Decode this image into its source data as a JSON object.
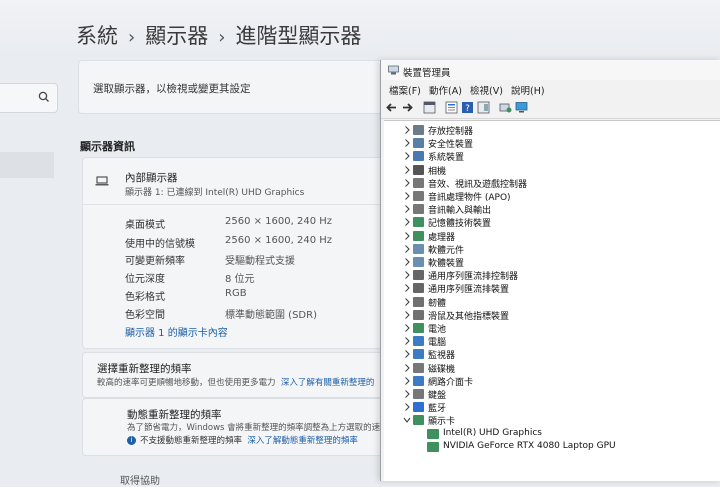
{
  "settings": {
    "breadcrumb": [
      "系統",
      "顯示器",
      "進階型顯示器"
    ],
    "select_display_label": "選取顯示器，以檢視或變更其設定",
    "display_info_title": "顯示器資訊",
    "display_name": "內部顯示器",
    "display_connection": "顯示器 1: 已連線到 Intel(R) UHD Graphics",
    "info_rows": [
      {
        "label": "桌面模式",
        "value": "2560 × 1600, 240 Hz"
      },
      {
        "label": "使用中的信號模",
        "value": "2560 × 1600, 240 Hz"
      },
      {
        "label": "可變更新頻率",
        "value": "受驅動程式支援"
      },
      {
        "label": "位元深度",
        "value": "8 位元"
      },
      {
        "label": "色彩格式",
        "value": "RGB"
      },
      {
        "label": "色彩空間",
        "value": "標準動態範圍 (SDR)"
      }
    ],
    "adapter_link": "顯示器 1 的顯示卡內容",
    "refresh_title": "選擇重新整理的頻率",
    "refresh_desc": "較高的速率可更順暢地移動，但也使用更多電力",
    "refresh_link": "深入了解有關重新整理的",
    "dynamic_title": "動態重新整理的頻率",
    "dynamic_desc": "為了節省電力，Windows 會將重新整理的頻率調整為上方選取的速",
    "dynamic_info": "不支援動態重新整理的頻率",
    "dynamic_link": "深入了解動態重新整理的頻率",
    "bottom_cut": "取得協助"
  },
  "device_manager": {
    "title": "裝置管理員",
    "menu": [
      "檔案(F)",
      "動作(A)",
      "檢視(V)",
      "說明(H)"
    ],
    "categories": [
      {
        "label": "存放控制器",
        "icon": "storage-icon",
        "color": "#6b7b8c"
      },
      {
        "label": "安全性裝置",
        "icon": "security-icon",
        "color": "#5a7fa6"
      },
      {
        "label": "系統裝置",
        "icon": "system-icon",
        "color": "#4a79b0"
      },
      {
        "label": "相機",
        "icon": "camera-icon",
        "color": "#555555"
      },
      {
        "label": "音效、視訊及遊戲控制器",
        "icon": "audio-icon",
        "color": "#777777"
      },
      {
        "label": "音訊處理物件 (APO)",
        "icon": "audio-icon",
        "color": "#777777"
      },
      {
        "label": "音訊輸入與輸出",
        "icon": "audio-io-icon",
        "color": "#777777"
      },
      {
        "label": "記憶體技術裝置",
        "icon": "memory-icon",
        "color": "#3f8f5f"
      },
      {
        "label": "處理器",
        "icon": "processor-icon",
        "color": "#3f8f5f"
      },
      {
        "label": "軟體元件",
        "icon": "software-icon",
        "color": "#6a8fb0"
      },
      {
        "label": "軟體裝置",
        "icon": "software-icon",
        "color": "#6a8fb0"
      },
      {
        "label": "通用序列匯流排控制器",
        "icon": "usb-icon",
        "color": "#666666"
      },
      {
        "label": "通用序列匯流排裝置",
        "icon": "usb-icon",
        "color": "#666666"
      },
      {
        "label": "韌體",
        "icon": "firmware-icon",
        "color": "#707070"
      },
      {
        "label": "滑鼠及其他指標裝置",
        "icon": "mouse-icon",
        "color": "#707070"
      },
      {
        "label": "電池",
        "icon": "battery-icon",
        "color": "#3f8f5f"
      },
      {
        "label": "電腦",
        "icon": "computer-icon",
        "color": "#3b7cc4"
      },
      {
        "label": "監視器",
        "icon": "monitor-icon",
        "color": "#3b7cc4"
      },
      {
        "label": "磁碟機",
        "icon": "disk-icon",
        "color": "#777777"
      },
      {
        "label": "網路介面卡",
        "icon": "network-icon",
        "color": "#3b7cc4"
      },
      {
        "label": "鍵盤",
        "icon": "keyboard-icon",
        "color": "#777777"
      },
      {
        "label": "藍牙",
        "icon": "bluetooth-icon",
        "color": "#2f6fd0"
      },
      {
        "label": "顯示卡",
        "icon": "display-adapter-icon",
        "color": "#3f8f5f",
        "expanded": true
      }
    ],
    "children": [
      {
        "label": "Intel(R) UHD Graphics",
        "icon": "display-adapter-icon",
        "color": "#3f8f5f"
      },
      {
        "label": "NVIDIA GeForce RTX 4080 Laptop GPU",
        "icon": "display-adapter-icon",
        "color": "#3f8f5f"
      }
    ]
  }
}
